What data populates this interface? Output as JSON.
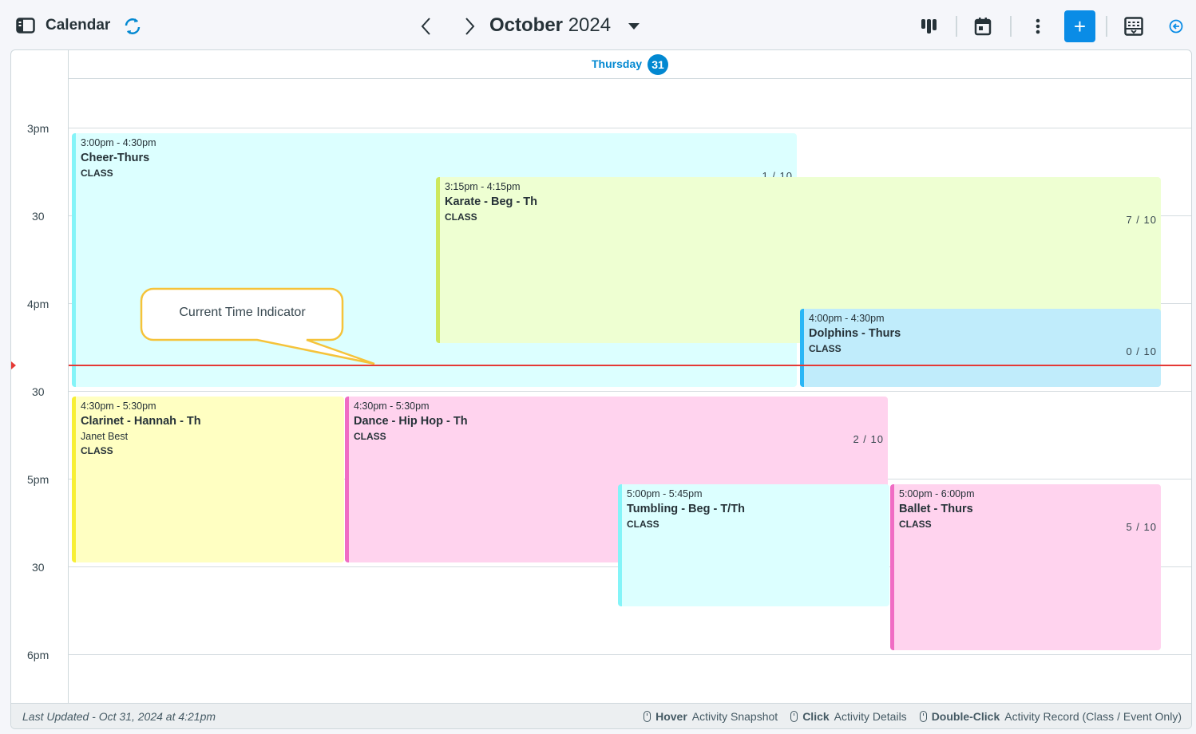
{
  "header": {
    "title": "Calendar",
    "month": "October",
    "year": "2024",
    "add_label": "+"
  },
  "day": {
    "name": "Thursday",
    "number": "31"
  },
  "times": [
    "3pm",
    "30",
    "4pm",
    "30",
    "5pm",
    "30",
    "6pm"
  ],
  "events": [
    {
      "time": "3:00pm - 4:30pm",
      "name": "Cheer-Thurs",
      "type": "CLASS",
      "count": "1 / 10",
      "bg": "#dcffff",
      "border": "#84f4f8"
    },
    {
      "time": "3:15pm - 4:15pm",
      "name": "Karate - Beg - Th",
      "type": "CLASS",
      "count": "7 / 10",
      "bg": "#eeffd2",
      "border": "#cde85e"
    },
    {
      "time": "4:00pm - 4:30pm",
      "name": "Dolphins - Thurs",
      "type": "CLASS",
      "count": "0 / 10",
      "bg": "#c0ecfb",
      "border": "#29b6f6"
    },
    {
      "time": "4:30pm - 5:30pm",
      "name": "Clarinet - Hannah - Th",
      "sub": "Janet Best",
      "type": "CLASS",
      "bg": "#ffffc2",
      "border": "#f7ef35"
    },
    {
      "time": "4:30pm - 5:30pm",
      "name": "Dance - Hip Hop - Th",
      "type": "CLASS",
      "count": "2 / 10",
      "bg": "#ffd3ee",
      "border": "#f06cc4"
    },
    {
      "time": "5:00pm - 5:45pm",
      "name": "Tumbling - Beg - T/Th",
      "type": "CLASS",
      "bg": "#dcffff",
      "border": "#84f4f8"
    },
    {
      "time": "5:00pm - 6:00pm",
      "name": "Ballet - Thurs",
      "type": "CLASS",
      "count": "5 / 10",
      "bg": "#ffd3ee",
      "border": "#f06cc4"
    }
  ],
  "callout": {
    "text": "Current Time Indicator"
  },
  "footer": {
    "last_updated": "Last Updated - Oct 31, 2024 at 4:21pm",
    "hints": [
      {
        "action": "Hover",
        "desc": "Activity Snapshot"
      },
      {
        "action": "Click",
        "desc": "Activity Details"
      },
      {
        "action": "Double-Click",
        "desc": "Activity Record (Class / Event Only)"
      }
    ]
  },
  "colors": {
    "accent": "#0288d1",
    "now_line": "#e53935",
    "callout_border": "#f5c33a"
  }
}
